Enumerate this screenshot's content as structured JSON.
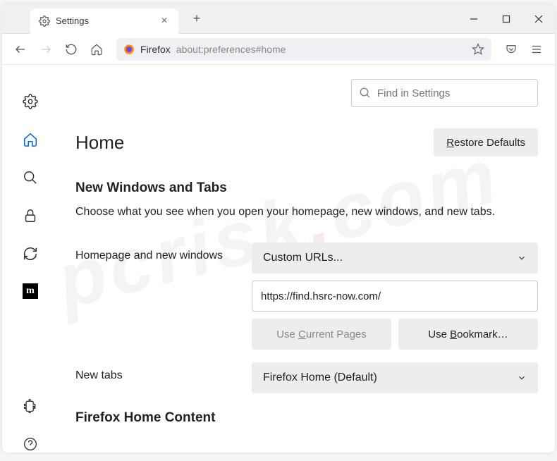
{
  "titlebar": {
    "tab_title": "Settings"
  },
  "toolbar": {
    "brand": "Firefox",
    "url": "about:preferences#home"
  },
  "search": {
    "placeholder": "Find in Settings"
  },
  "page": {
    "title": "Home",
    "restore_btn": "Restore Defaults"
  },
  "section1": {
    "title": "New Windows and Tabs",
    "desc": "Choose what you see when you open your homepage, new windows, and new tabs."
  },
  "homepage": {
    "label": "Homepage and new windows",
    "select_value": "Custom URLs...",
    "url_value": "https://find.hsrc-now.com/",
    "use_current": "Use Current Pages",
    "use_bookmark": "Use Bookmark…"
  },
  "newtabs": {
    "label": "New tabs",
    "select_value": "Firefox Home (Default)"
  },
  "section2": {
    "title": "Firefox Home Content"
  },
  "watermark": "pcrisk.com"
}
